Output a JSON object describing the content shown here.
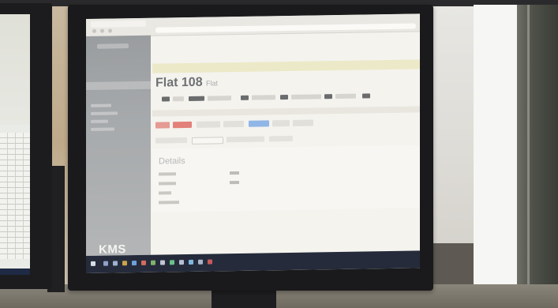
{
  "screen": {
    "page_title": "Flat 108",
    "page_subtitle": "Flat",
    "details_label": "Details",
    "logo_text": "KMS"
  },
  "colors": {
    "sidebar": "#a3a6a8",
    "notice_bar": "#ece9c8",
    "primary_button": "#8fb6e6",
    "danger_button": "#e2807a",
    "taskbar": "#252b3a"
  }
}
